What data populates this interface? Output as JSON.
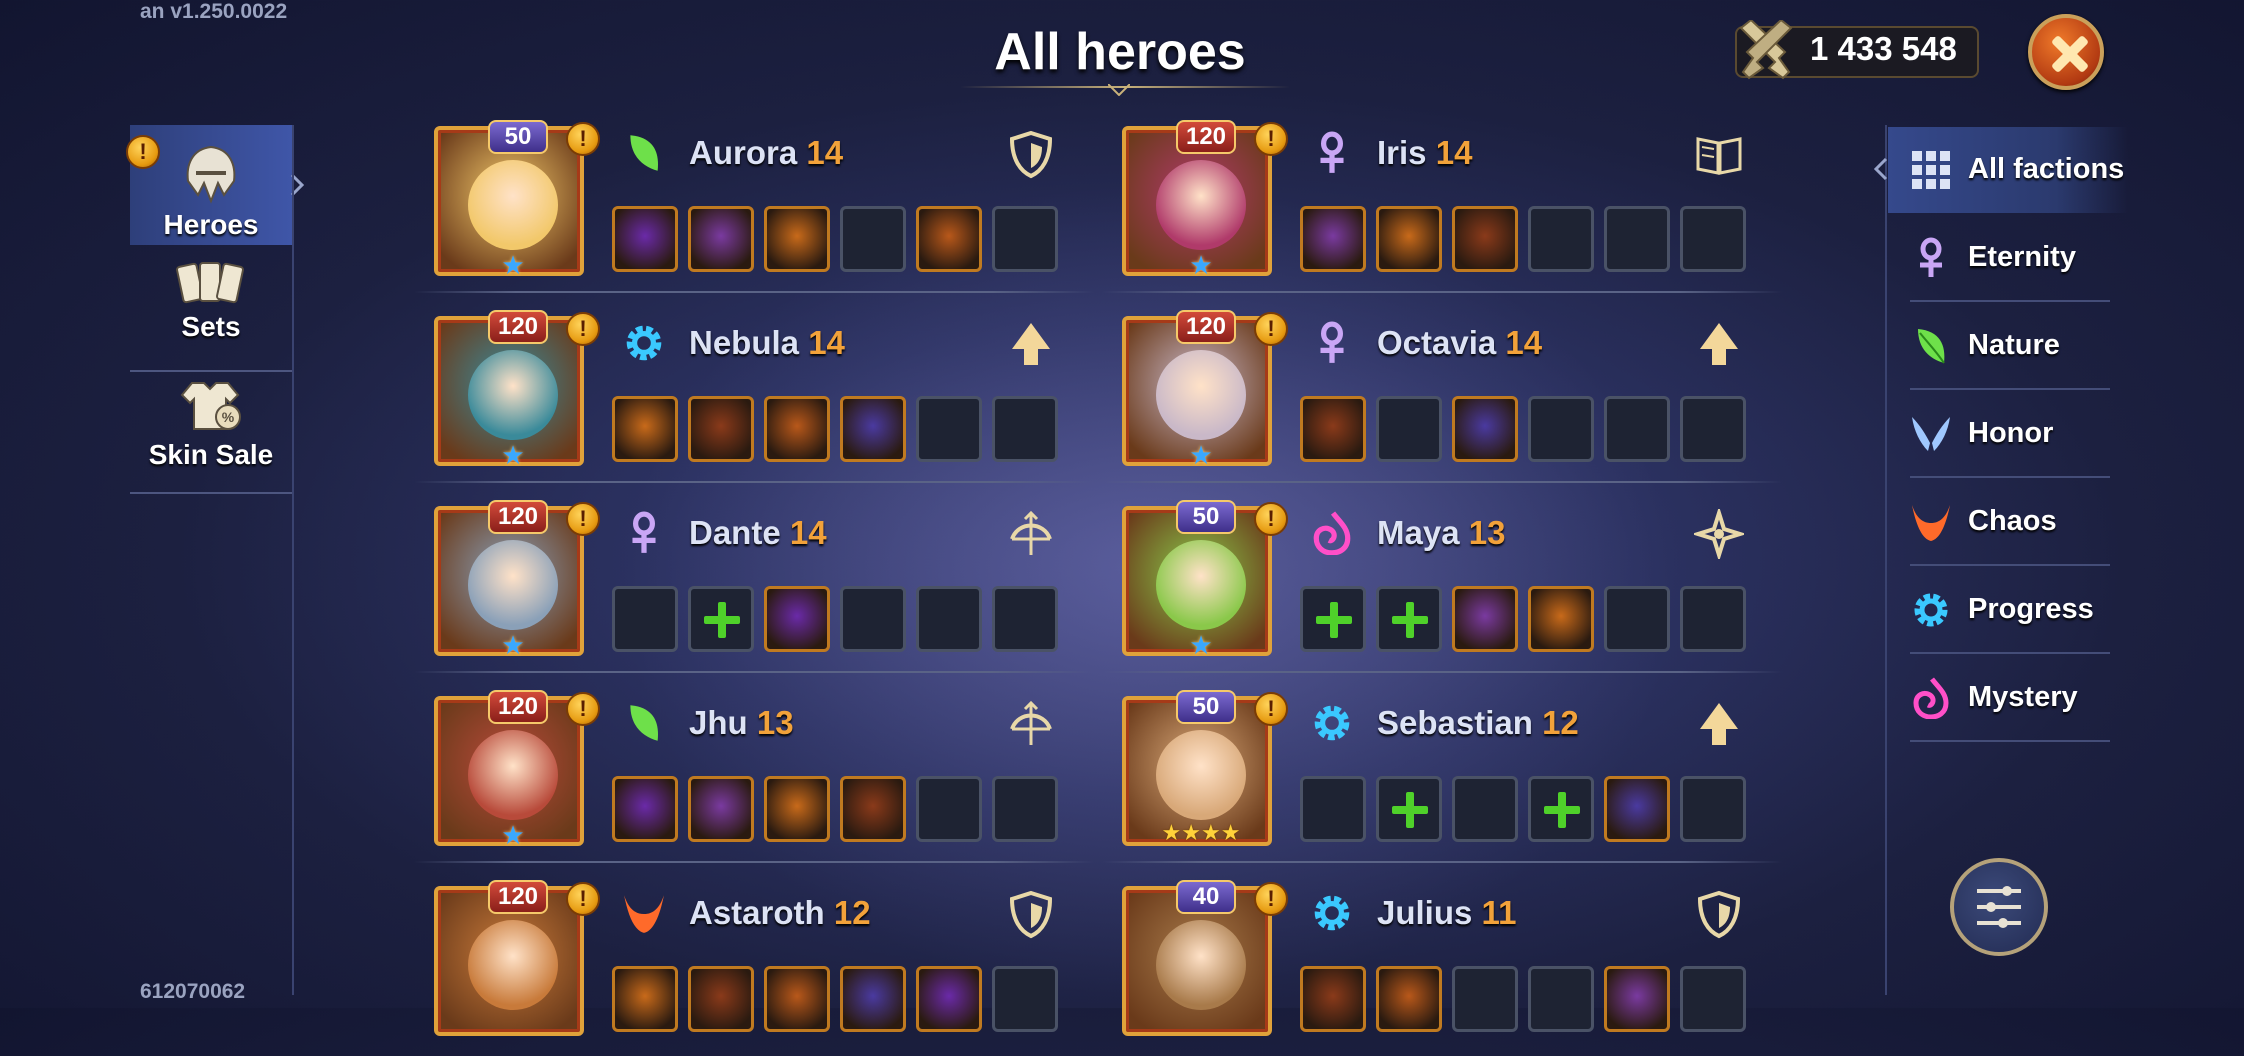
{
  "version": "an v1.250.0022",
  "build": "612070062",
  "title": "All heroes",
  "power": "1 433 548",
  "left_tabs": [
    {
      "label": "Heroes",
      "icon": "helmet-icon",
      "active": true,
      "alert": true
    },
    {
      "label": "Sets",
      "icon": "cards-icon",
      "active": false,
      "alert": false
    },
    {
      "label": "Skin Sale",
      "icon": "shirt-tag-icon",
      "active": false,
      "alert": false
    }
  ],
  "factions": [
    {
      "label": "All factions",
      "icon": "grid-icon",
      "color": "#ffffff",
      "active": true
    },
    {
      "label": "Eternity",
      "icon": "ankh-icon",
      "color": "#c9a6f5"
    },
    {
      "label": "Nature",
      "icon": "leaf-icon",
      "color": "#6ee04a"
    },
    {
      "label": "Honor",
      "icon": "wings-icon",
      "color": "#9fc8ff"
    },
    {
      "label": "Chaos",
      "icon": "horned-icon",
      "color": "#ff6a2a"
    },
    {
      "label": "Progress",
      "icon": "cog-icon",
      "color": "#3ac9ff"
    },
    {
      "label": "Mystery",
      "icon": "swirl-icon",
      "color": "#ff4fc8"
    }
  ],
  "heroes": [
    {
      "name": "Aurora",
      "level_num": "14",
      "badge": "50",
      "badge_type": "asc",
      "stars": "★",
      "star_type": "blue",
      "faction": "nature",
      "role": "shield",
      "face": "#f2c86a",
      "slots": [
        "item",
        "item",
        "item",
        "empty",
        "item",
        "empty"
      ]
    },
    {
      "name": "Iris",
      "level_num": "14",
      "badge": "120",
      "badge_type": "lvl",
      "stars": "★",
      "star_type": "blue",
      "faction": "eternity",
      "role": "book",
      "face": "#b03a6a",
      "slots": [
        "item",
        "item",
        "item",
        "empty",
        "empty",
        "empty"
      ]
    },
    {
      "name": "Nebula",
      "level_num": "14",
      "badge": "120",
      "badge_type": "lvl",
      "stars": "★",
      "star_type": "blue",
      "faction": "progress",
      "role": "arrow",
      "face": "#3a8a9a",
      "slots": [
        "item",
        "item",
        "item",
        "item",
        "empty",
        "empty"
      ]
    },
    {
      "name": "Octavia",
      "level_num": "14",
      "badge": "120",
      "badge_type": "lvl",
      "stars": "★",
      "star_type": "blue",
      "faction": "eternity",
      "role": "arrow",
      "face": "#c9b8c8",
      "slots": [
        "item",
        "empty",
        "item",
        "empty",
        "empty",
        "empty"
      ]
    },
    {
      "name": "Dante",
      "level_num": "14",
      "badge": "120",
      "badge_type": "lvl",
      "stars": "★",
      "star_type": "blue",
      "faction": "eternity",
      "role": "bow",
      "face": "#8aa0b8",
      "slots": [
        "empty",
        "plus",
        "item",
        "empty",
        "empty",
        "empty"
      ]
    },
    {
      "name": "Maya",
      "level_num": "13",
      "badge": "50",
      "badge_type": "asc",
      "stars": "★",
      "star_type": "blue",
      "faction": "mystery",
      "role": "cross",
      "face": "#8ac84a",
      "slots": [
        "plus",
        "plus",
        "item",
        "item",
        "empty",
        "empty"
      ]
    },
    {
      "name": "Jhu",
      "level_num": "13",
      "badge": "120",
      "badge_type": "lvl",
      "stars": "★",
      "star_type": "blue",
      "faction": "nature",
      "role": "bow",
      "face": "#b84a3a",
      "slots": [
        "item",
        "item",
        "item",
        "item",
        "empty",
        "empty"
      ]
    },
    {
      "name": "Sebastian",
      "level_num": "12",
      "badge": "50",
      "badge_type": "asc",
      "stars": "★★★★",
      "star_type": "gold",
      "faction": "progress",
      "role": "arrow",
      "face": "#d8a878",
      "slots": [
        "empty",
        "plus",
        "empty",
        "plus",
        "item",
        "empty"
      ]
    },
    {
      "name": "Astaroth",
      "level_num": "12",
      "badge": "120",
      "badge_type": "lvl",
      "stars": "",
      "star_type": "blue",
      "faction": "chaos",
      "role": "shield",
      "face": "#c87a3a",
      "slots": [
        "item",
        "item",
        "item",
        "item",
        "item",
        "empty"
      ]
    },
    {
      "name": "Julius",
      "level_num": "11",
      "badge": "40",
      "badge_type": "asc",
      "stars": "",
      "star_type": "blue",
      "faction": "progress",
      "role": "shield",
      "face": "#a87a4a",
      "slots": [
        "item",
        "item",
        "empty",
        "empty",
        "item",
        "empty"
      ]
    }
  ],
  "colors": {
    "accent_gold": "#f2a23a",
    "alert_orange": "#e69a10"
  }
}
